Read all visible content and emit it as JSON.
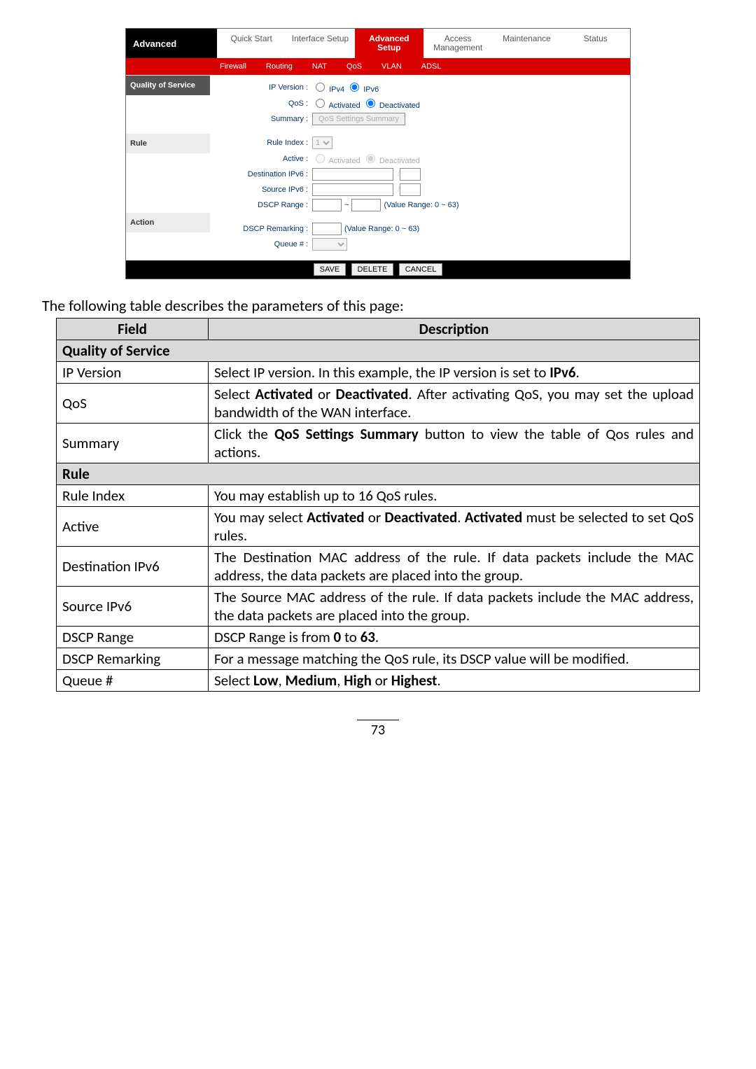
{
  "router": {
    "brand": "Advanced",
    "main_nav": [
      "Quick Start",
      "Interface Setup",
      "Advanced Setup",
      "Access Management",
      "Maintenance",
      "Status"
    ],
    "sub_nav": [
      "Firewall",
      "Routing",
      "NAT",
      "QoS",
      "VLAN",
      "ADSL"
    ],
    "sidebar": {
      "qos": "Quality of Service",
      "rule": "Rule",
      "action": "Action"
    },
    "qos": {
      "ip_version_label": "IP Version :",
      "ipv4": "IPv4",
      "ipv6": "IPv6",
      "qos_label": "QoS :",
      "activated": "Activated",
      "deactivated": "Deactivated",
      "summary_label": "Summary :",
      "summary_btn": "QoS Settings Summary"
    },
    "rule": {
      "index_label": "Rule Index :",
      "index_value": "1",
      "active_label": "Active :",
      "activated": "Activated",
      "deactivated": "Deactivated",
      "dst_label": "Destination IPv6 :",
      "src_label": "Source IPv6 :",
      "dscp_label": "DSCP Range :",
      "tilde": "~",
      "dscp_hint": "(Value Range: 0 ~ 63)"
    },
    "action": {
      "remark_label": "DSCP Remarking :",
      "remark_hint": "(Value Range: 0 ~ 63)",
      "queue_label": "Queue # :"
    },
    "buttons": {
      "save": "SAVE",
      "delete": "DELETE",
      "cancel": "CANCEL"
    }
  },
  "lead": "The following table describes the parameters of this page:",
  "table": {
    "hField": "Field",
    "hDesc": "Description",
    "sec1": "Quality of Service",
    "ipv_k": "IP Version",
    "ipv_v_a": "Select IP version. In this example, the IP version is set to ",
    "ipv_v_b": "IPv6",
    "ipv_v_c": ".",
    "qos_k": "QoS",
    "qos_v_a": "Select ",
    "qos_v_b": "Activated",
    "qos_v_c": " or ",
    "qos_v_d": "Deactivated",
    "qos_v_e": ". After activating QoS, you may set the upload bandwidth of the WAN interface.",
    "sum_k": "Summary",
    "sum_v_a": "Click the ",
    "sum_v_b": "QoS Settings Summary",
    "sum_v_c": " button to view the table of Qos rules and actions.",
    "sec2": "Rule",
    "ri_k": "Rule Index",
    "ri_v": "You may establish up to 16 QoS rules.",
    "act_k": "Active",
    "act_v_a": "You may select ",
    "act_v_b": "Activated",
    "act_v_c": " or ",
    "act_v_d": "Deactivated",
    "act_v_e": ". ",
    "act_v_f": "Activated",
    "act_v_g": " must be selected to set QoS rules.",
    "dst_k": "Destination IPv6",
    "dst_v": "The Destination MAC address of the rule. If data packets include the MAC address, the data packets are placed into the group.",
    "src_k": "Source IPv6",
    "src_v": "The Source MAC address of the rule. If data packets include the MAC address, the data packets are placed into the group.",
    "dscp_k": "DSCP Range",
    "dscp_v_a": "DSCP Range is from ",
    "dscp_v_b": "0",
    "dscp_v_c": " to ",
    "dscp_v_d": "63",
    "dscp_v_e": ".",
    "rem_k": "DSCP Remarking",
    "rem_v": "For a message matching the QoS rule, its DSCP value will be modified.",
    "q_k": "Queue #",
    "q_v_a": "Select ",
    "q_v_b": "Low",
    "q_v_c": ", ",
    "q_v_d": "Medium",
    "q_v_e": ", ",
    "q_v_f": "High",
    "q_v_g": " or ",
    "q_v_h": "Highest",
    "q_v_i": "."
  },
  "page_number": "73"
}
